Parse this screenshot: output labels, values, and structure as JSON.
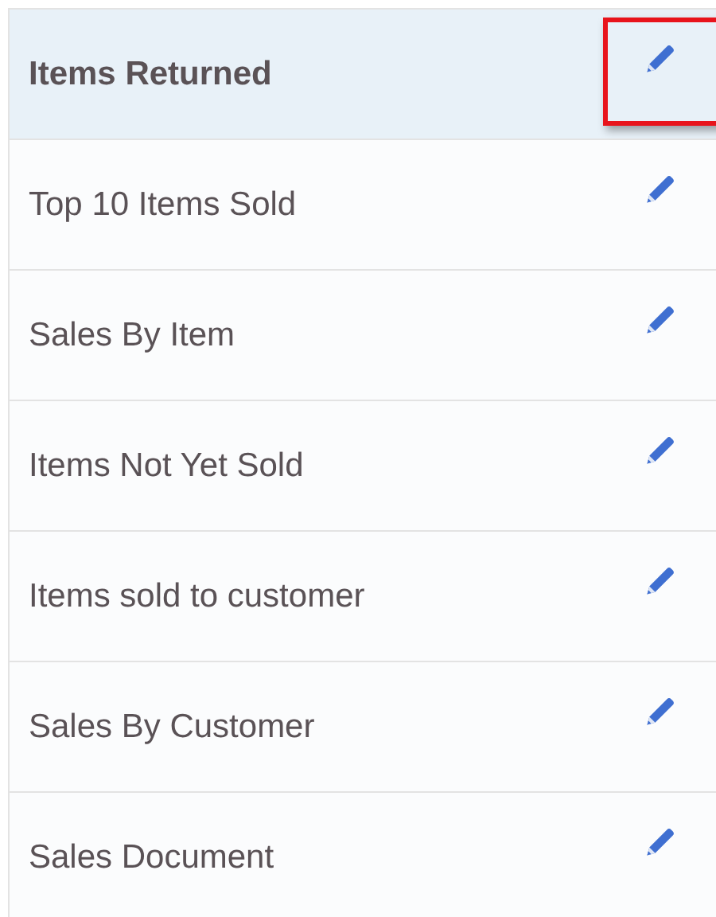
{
  "items": [
    {
      "label": "Items Returned",
      "selected": true,
      "edit_highlighted": true
    },
    {
      "label": "Top 10 Items Sold",
      "selected": false,
      "edit_highlighted": false
    },
    {
      "label": "Sales By Item",
      "selected": false,
      "edit_highlighted": false
    },
    {
      "label": "Items Not Yet Sold",
      "selected": false,
      "edit_highlighted": false
    },
    {
      "label": "Items sold to customer",
      "selected": false,
      "edit_highlighted": false
    },
    {
      "label": "Sales By Customer",
      "selected": false,
      "edit_highlighted": false
    },
    {
      "label": "Sales Document",
      "selected": false,
      "edit_highlighted": false
    }
  ]
}
